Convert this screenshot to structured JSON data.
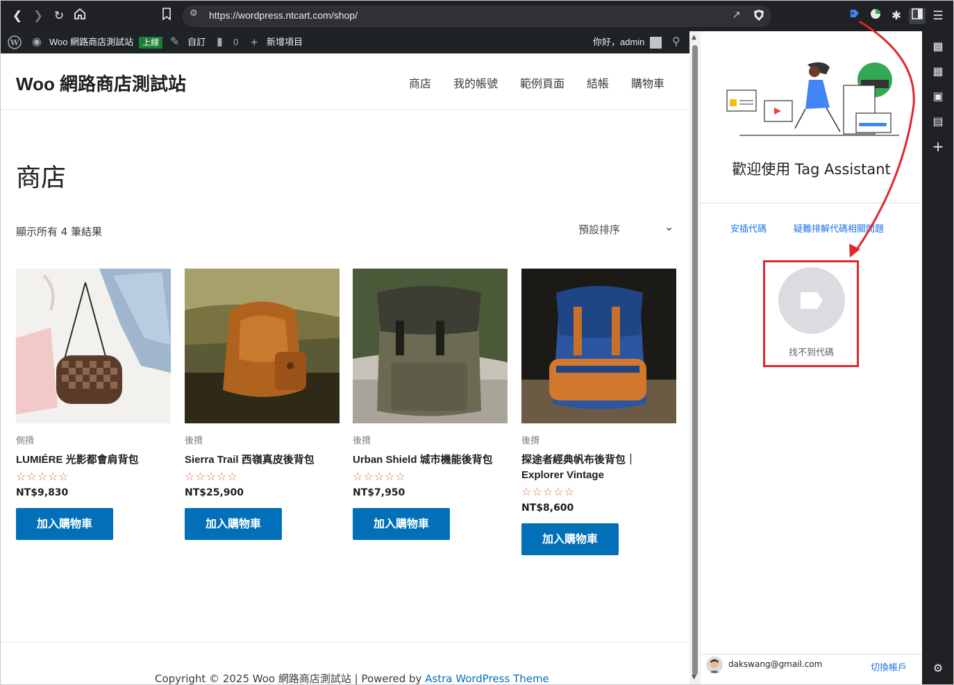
{
  "browser": {
    "url": "https://wordpress.ntcart.com/shop/"
  },
  "adminbar": {
    "site_name": "Woo 網路商店測試站",
    "live_badge": "上線",
    "customize": "自訂",
    "comments_count": "0",
    "new_item": "新增項目",
    "greeting": "你好，admin"
  },
  "site": {
    "title": "Woo 網路商店測試站",
    "nav": [
      "商店",
      "我的帳號",
      "範例頁面",
      "結帳",
      "購物車"
    ],
    "page_heading": "商店",
    "result_count": "顯示所有 4 筆結果",
    "sort_label": "預設排序",
    "products": [
      {
        "category": "側揹",
        "title": "LUMIÉRE 光影都會肩背包",
        "stars": "☆☆☆☆☆",
        "price": "NT$9,830",
        "button": "加入購物車"
      },
      {
        "category": "後揹",
        "title": "Sierra Trail 西嶺真皮後背包",
        "stars": "☆☆☆☆☆",
        "price": "NT$25,900",
        "button": "加入購物車"
      },
      {
        "category": "後揹",
        "title": "Urban Shield 城市機能後背包",
        "stars": "☆☆☆☆☆",
        "price": "NT$7,950",
        "button": "加入購物車"
      },
      {
        "category": "後揹",
        "title": "探途者經典帆布後背包｜Explorer Vintage",
        "stars": "☆☆☆☆☆",
        "price": "NT$8,600",
        "button": "加入購物車"
      }
    ],
    "footer": {
      "text": "Copyright © 2025 Woo 網路商店測試站 | Powered by ",
      "link": "Astra WordPress Theme"
    }
  },
  "panel": {
    "welcome": "歡迎使用 Tag Assistant",
    "link_install": "安插代碼",
    "link_troubleshoot": "疑難排解代碼相關問題",
    "no_tag": "找不到代碼",
    "account_email": "dakswang@gmail.com",
    "switch_account": "切換帳戶"
  },
  "colors": {
    "accent": "#0170b9",
    "panel_link": "#1a73e8",
    "highlight": "#e0262d",
    "admin_bar": "#1d2327",
    "chrome": "#202124"
  }
}
